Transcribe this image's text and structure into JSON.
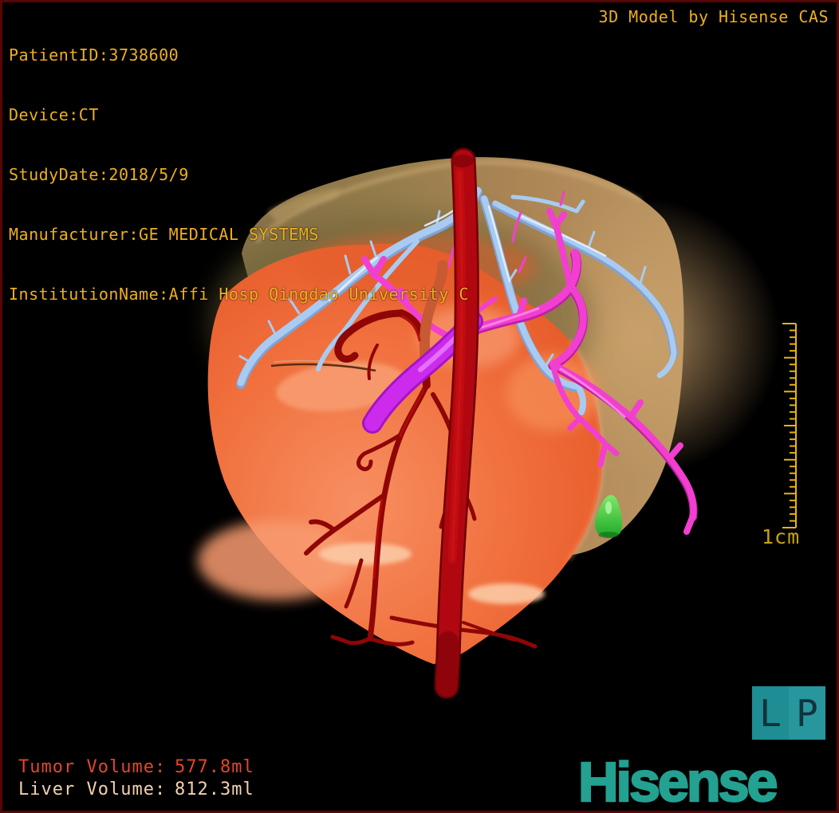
{
  "header": {
    "patient_info_lines": [
      "PatientID:3738600",
      "Device:CT",
      "StudyDate:2018/5/9",
      "Manufacturer:GE MEDICAL SYSTEMS",
      "InstitutionName:Affi Hosp Qingdao University C"
    ],
    "watermark": "3D Model by Hisense CAS"
  },
  "measurements": {
    "tumor_label": "Tumor Volume:",
    "tumor_value": "577.8ml",
    "liver_label": "Liver Volume:",
    "liver_value": "812.3ml"
  },
  "ruler": {
    "label": "1cm"
  },
  "orientation_marker": {
    "left_letter": "L",
    "right_letter": "P"
  },
  "brand": {
    "logo_text": "Hisense"
  },
  "model": {
    "structures": [
      {
        "name": "liver",
        "color": "#AD8452"
      },
      {
        "name": "tumor",
        "color": "#F0703E"
      },
      {
        "name": "hepatic-veins",
        "color": "#A9CBF1"
      },
      {
        "name": "portal-vein",
        "color": "#F23FD0"
      },
      {
        "name": "portal-vein-trunk",
        "color": "#CC2BEE"
      },
      {
        "name": "hepatic-artery",
        "color": "#8F0606"
      },
      {
        "name": "aorta",
        "color": "#B3070F"
      },
      {
        "name": "gallbladder",
        "color": "#35C93B"
      }
    ]
  },
  "colors": {
    "overlay_text": "#EFAF1E",
    "tumor_text": "#E2472B",
    "liver_text": "#F3D2AC",
    "brand_teal": "#23A191",
    "ruler_gold": "#E6B50A",
    "frame_border": "#570606",
    "background": "#000000"
  }
}
